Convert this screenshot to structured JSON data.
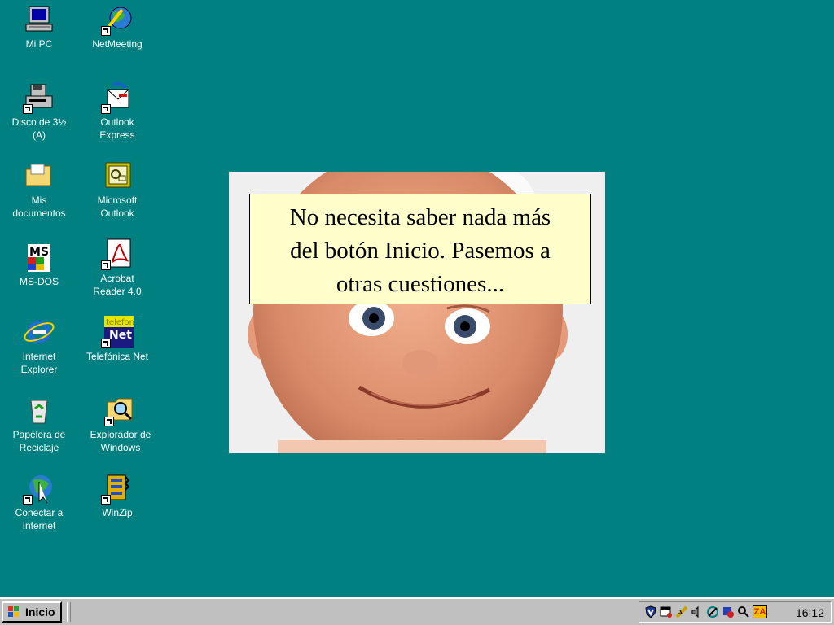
{
  "desktop": {
    "icons": [
      {
        "label": "Mi PC"
      },
      {
        "label": "NetMeeting"
      },
      {
        "label": "Disco de 3½\n(A)"
      },
      {
        "label": "Outlook\nExpress"
      },
      {
        "label": "Mis\ndocumentos"
      },
      {
        "label": "Microsoft\nOutlook"
      },
      {
        "label": "MS-DOS"
      },
      {
        "label": "Acrobat\nReader 4.0"
      },
      {
        "label": "Internet\nExplorer"
      },
      {
        "label": "Telefónica Net"
      },
      {
        "label": "Papelera de\nReciclaje"
      },
      {
        "label": "Explorador de\nWindows"
      },
      {
        "label": "Conectar a\nInternet"
      },
      {
        "label": "WinZip"
      }
    ],
    "telefonica_icon_text": {
      "top": "telefon",
      "bottom": "Net"
    },
    "msdos_icon_text": "MS"
  },
  "slide": {
    "caption_lines": [
      "No necesita saber nada más",
      "del botón Inicio. Pasemos a",
      "otras cuestiones..."
    ]
  },
  "taskbar": {
    "start_label": "Inicio",
    "clock": "16:12",
    "tray_icons": [
      "shield-icon",
      "calendar-icon",
      "network-icon",
      "speaker-icon",
      "connection-icon",
      "security-icon",
      "search-icon",
      "zonealarm-icon"
    ],
    "tray_badge_za": "ZA"
  }
}
